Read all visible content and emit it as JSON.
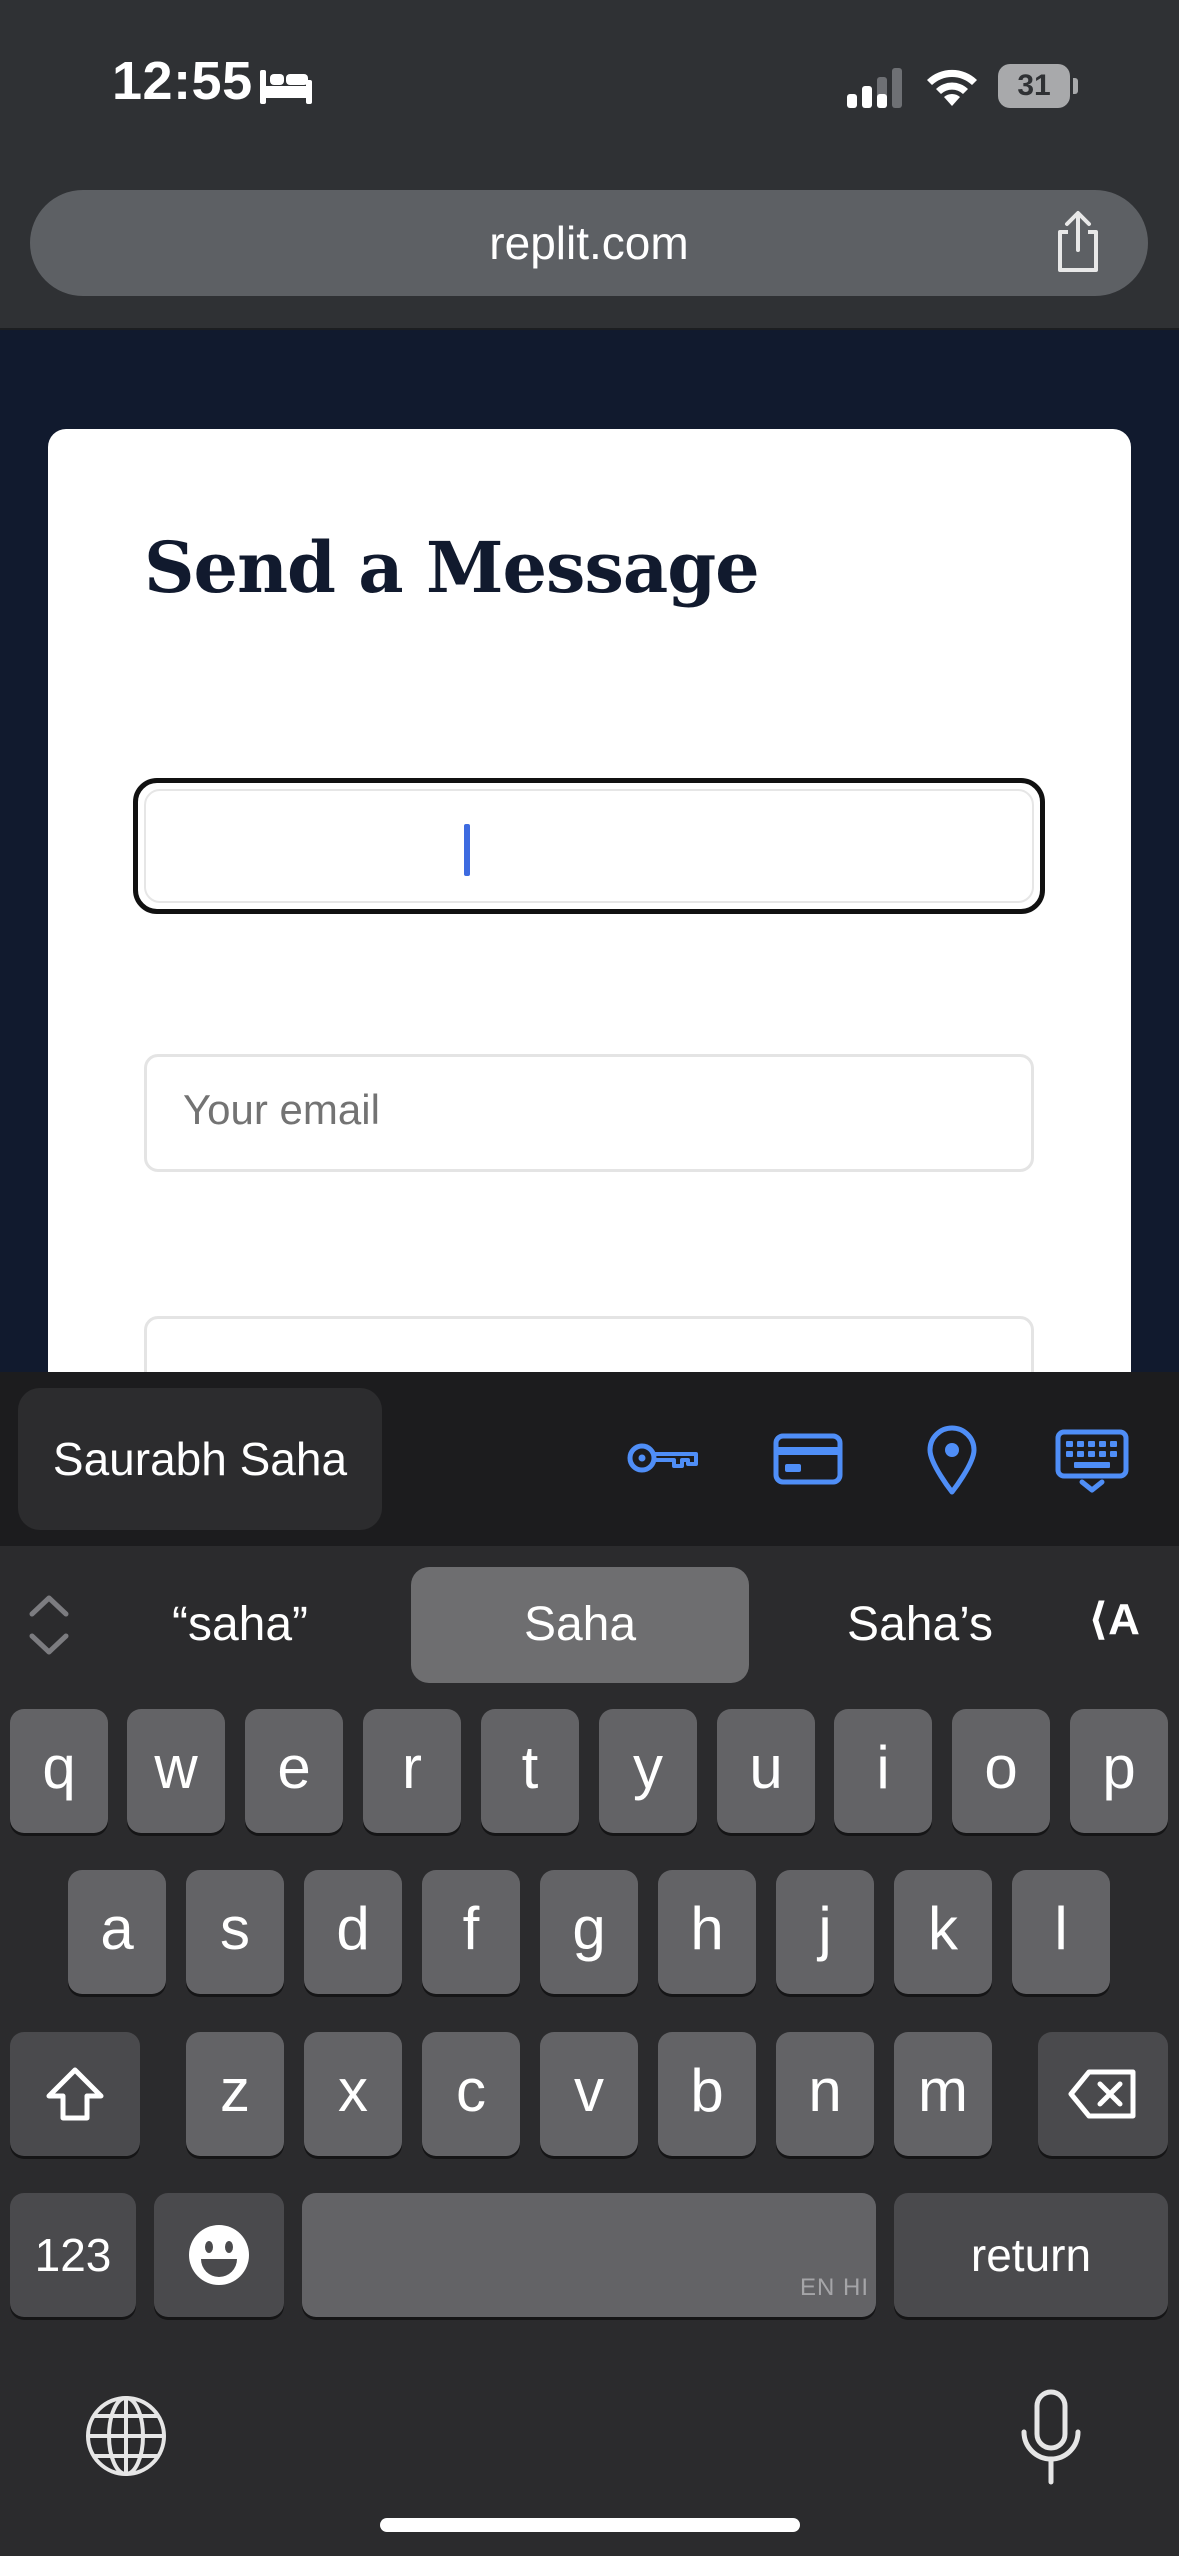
{
  "status_bar": {
    "time": "12:55",
    "battery_level": "31",
    "icons": [
      "bed-icon",
      "signal-icon",
      "wifi-icon",
      "battery-icon"
    ]
  },
  "browser": {
    "url": "replit.com",
    "share_icon": "share-icon"
  },
  "form": {
    "title": "Send a Message",
    "name_value": "",
    "email_placeholder": "Your email",
    "accent_color": "#3d6be0"
  },
  "autofill": {
    "suggestion": "Saurabh Saha",
    "icons": [
      "key-icon",
      "credit-card-icon",
      "location-pin-icon",
      "keyboard-dismiss-icon"
    ],
    "icon_color": "#4f8ef7"
  },
  "keyboard": {
    "predictions": [
      "“saha”",
      "Saha",
      "Saha’s"
    ],
    "row1": [
      "q",
      "w",
      "e",
      "r",
      "t",
      "y",
      "u",
      "i",
      "o",
      "p"
    ],
    "row2": [
      "a",
      "s",
      "d",
      "f",
      "g",
      "h",
      "j",
      "k",
      "l"
    ],
    "row3": [
      "z",
      "x",
      "c",
      "v",
      "b",
      "n",
      "m"
    ],
    "numbers_label": "123",
    "space_language": "EN HI",
    "return_label": "return",
    "icons": [
      "chevron-updown-icon",
      "text-format-icon",
      "shift-icon",
      "backspace-icon",
      "emoji-icon",
      "globe-icon",
      "microphone-icon"
    ]
  }
}
